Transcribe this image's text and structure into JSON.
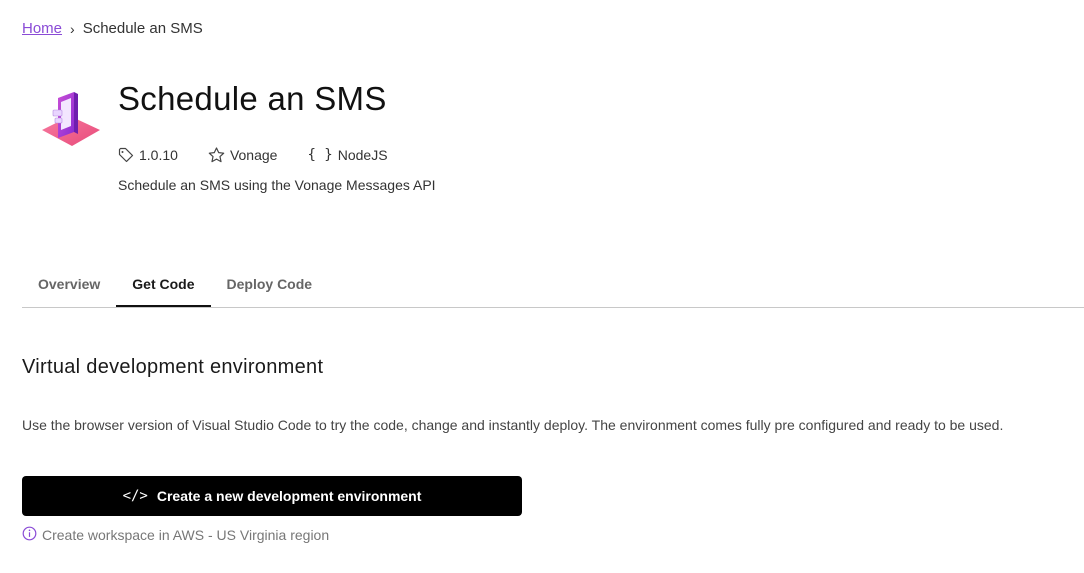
{
  "breadcrumb": {
    "home": "Home",
    "separator": "›",
    "current": "Schedule an SMS"
  },
  "header": {
    "icon": "sms-phone-illustration-icon",
    "title": "Schedule an SMS",
    "version": "1.0.10",
    "author": "Vonage",
    "language": "NodeJS",
    "description": "Schedule an SMS using the Vonage Messages API"
  },
  "tabs": [
    {
      "label": "Overview",
      "active": false
    },
    {
      "label": "Get Code",
      "active": true
    },
    {
      "label": "Deploy Code",
      "active": false
    }
  ],
  "section": {
    "title": "Virtual development environment",
    "text": "Use the browser version of Visual Studio Code to try the code, change and instantly deploy. The environment comes fully pre configured and ready to be used.",
    "button_label": "Create a new development environment",
    "button_icon": "</>",
    "region_note": "Create workspace in AWS - US Virginia region"
  },
  "colors": {
    "accent": "#8a4bd6",
    "button_bg": "#000000",
    "tab_active_underline": "#111111"
  }
}
